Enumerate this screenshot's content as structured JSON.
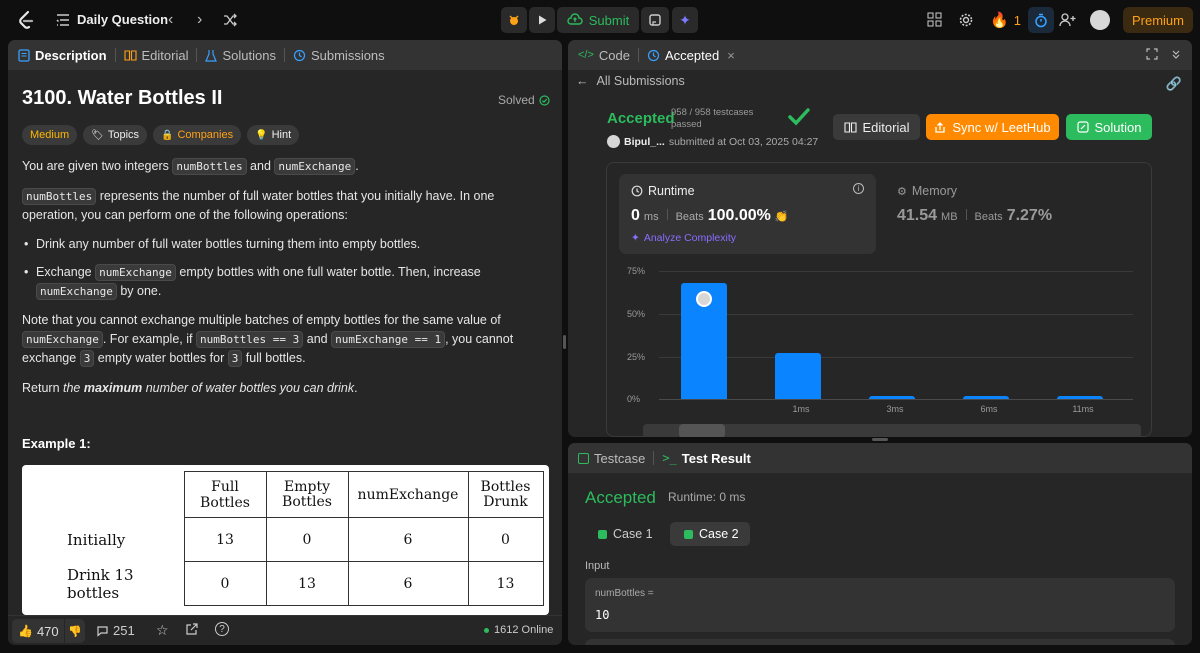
{
  "topbar": {
    "title": "Daily Question",
    "submit_label": "Submit",
    "streak_count": "1",
    "premium_label": "Premium"
  },
  "left": {
    "tabs": [
      "Description",
      "Editorial",
      "Solutions",
      "Submissions"
    ],
    "problem_title": "3100. Water Bottles II",
    "solved_label": "Solved",
    "tags": [
      "Medium",
      "Topics",
      "Companies",
      "Hint"
    ],
    "p1_a": "You are given two integers ",
    "code_numBottles": "numBottles",
    "p1_and": " and ",
    "code_numExchange": "numExchange",
    "p1_end": ".",
    "p2_rest": " represents the number of full water bottles that you initially have. In one operation, you can perform one of the following operations:",
    "bullet1": "Drink any number of full water bottles turning them into empty bottles.",
    "bullet2_a": "Exchange ",
    "bullet2_b": " empty bottles with one full water bottle. Then, increase ",
    "bullet2_c": " by one.",
    "p3_a": "Note that you cannot exchange multiple batches of empty bottles for the same value of ",
    "p3_b": ". For example, if ",
    "code_eq3": "numBottles == 3",
    "p3_c": " and ",
    "code_eq1": "numExchange == 1",
    "p3_d": ", you cannot exchange ",
    "code_3": "3",
    "p3_e": " empty water bottles for ",
    "p3_f": " full bottles.",
    "p4_a": "Return ",
    "p4_b": "the ",
    "p4_strong": "maximum",
    "p4_c": " number of water bottles you can drink",
    "p4_d": ".",
    "example_title": "Example 1:",
    "table": {
      "headers": [
        "Full Bottles",
        "Empty\nBottles",
        "numExchange",
        "Bottles\nDrunk"
      ],
      "rows": [
        [
          "Initially",
          "13",
          "0",
          "6",
          "0"
        ],
        [
          "Drink 13 bottles",
          "0",
          "13",
          "6",
          "13"
        ]
      ]
    },
    "likes": "470",
    "comments": "251",
    "online": "1612 Online"
  },
  "code_panel": {
    "tabs": [
      "Code",
      "Accepted"
    ],
    "back_label": "All Submissions",
    "status": "Accepted",
    "testcases": "958 / 958 testcases",
    "passed": "passed",
    "user": "Bipul_...",
    "submitted_at": "submitted at Oct 03, 2025 04:27",
    "editorial_label": "Editorial",
    "sync_label": "Sync w/ LeetHub",
    "solution_label": "Solution",
    "runtime_label": "Runtime",
    "runtime_value": "0",
    "runtime_unit": "ms",
    "beats_label": "Beats",
    "runtime_beats": "100.00%",
    "analyze_label": "Analyze Complexity",
    "memory_label": "Memory",
    "memory_value": "41.54",
    "memory_unit": "MB",
    "memory_beats": "7.27%"
  },
  "chart_data": {
    "type": "bar",
    "y_ticks": [
      "75%",
      "50%",
      "25%",
      "0%"
    ],
    "ylim": [
      0,
      75
    ],
    "categories": [
      "",
      "1ms",
      "3ms",
      "6ms",
      "11ms"
    ],
    "values": [
      68,
      27,
      2,
      2,
      2
    ]
  },
  "result_panel": {
    "tabs": [
      "Testcase",
      "Test Result"
    ],
    "status": "Accepted",
    "runtime": "Runtime: 0 ms",
    "cases": [
      "Case 1",
      "Case 2"
    ],
    "input_label": "Input",
    "var_label": "numBottles =",
    "var_value": "10"
  },
  "colors": {
    "accepted": "#2cbb5d",
    "orange": "#ffa116",
    "bar": "#0a84ff"
  }
}
